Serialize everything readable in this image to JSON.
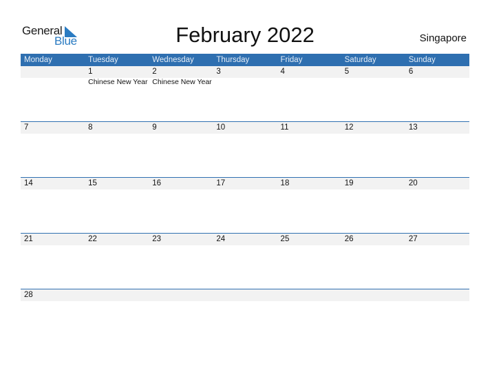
{
  "logo": {
    "word1": "General",
    "word2": "Blue",
    "icon": "triangle-flag-icon",
    "accent": "#2a7bc2"
  },
  "title": "February 2022",
  "country": "Singapore",
  "colors": {
    "header_bg": "#2e6fb0",
    "band_bg": "#f2f2f2"
  },
  "weekdays": [
    "Monday",
    "Tuesday",
    "Wednesday",
    "Thursday",
    "Friday",
    "Saturday",
    "Sunday"
  ],
  "weeks": [
    [
      {
        "day": "",
        "event": ""
      },
      {
        "day": "1",
        "event": "Chinese New Year"
      },
      {
        "day": "2",
        "event": "Chinese New Year"
      },
      {
        "day": "3",
        "event": ""
      },
      {
        "day": "4",
        "event": ""
      },
      {
        "day": "5",
        "event": ""
      },
      {
        "day": "6",
        "event": ""
      }
    ],
    [
      {
        "day": "7",
        "event": ""
      },
      {
        "day": "8",
        "event": ""
      },
      {
        "day": "9",
        "event": ""
      },
      {
        "day": "10",
        "event": ""
      },
      {
        "day": "11",
        "event": ""
      },
      {
        "day": "12",
        "event": ""
      },
      {
        "day": "13",
        "event": ""
      }
    ],
    [
      {
        "day": "14",
        "event": ""
      },
      {
        "day": "15",
        "event": ""
      },
      {
        "day": "16",
        "event": ""
      },
      {
        "day": "17",
        "event": ""
      },
      {
        "day": "18",
        "event": ""
      },
      {
        "day": "19",
        "event": ""
      },
      {
        "day": "20",
        "event": ""
      }
    ],
    [
      {
        "day": "21",
        "event": ""
      },
      {
        "day": "22",
        "event": ""
      },
      {
        "day": "23",
        "event": ""
      },
      {
        "day": "24",
        "event": ""
      },
      {
        "day": "25",
        "event": ""
      },
      {
        "day": "26",
        "event": ""
      },
      {
        "day": "27",
        "event": ""
      }
    ],
    [
      {
        "day": "28",
        "event": ""
      },
      {
        "day": "",
        "event": ""
      },
      {
        "day": "",
        "event": ""
      },
      {
        "day": "",
        "event": ""
      },
      {
        "day": "",
        "event": ""
      },
      {
        "day": "",
        "event": ""
      },
      {
        "day": "",
        "event": ""
      }
    ]
  ]
}
